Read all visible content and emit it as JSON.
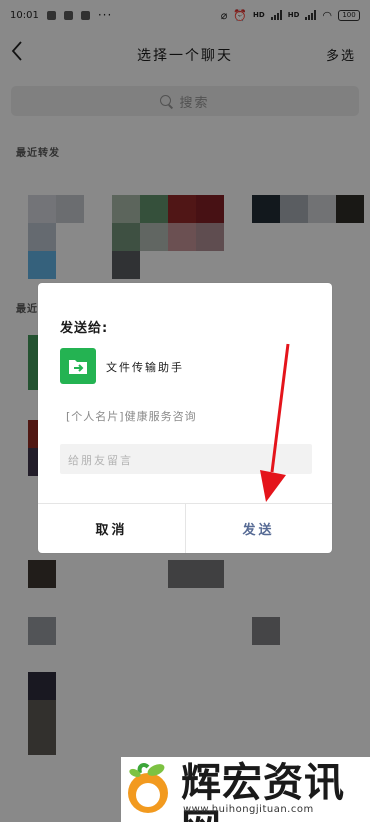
{
  "status_bar": {
    "time": "10:01",
    "dots": "···",
    "hd_label": "HD",
    "battery": "100"
  },
  "nav": {
    "back_icon": "chevron-left",
    "title": "选择一个聊天",
    "multi_select": "多选"
  },
  "search": {
    "placeholder": "搜索",
    "icon": "search-icon"
  },
  "sections": {
    "recent_forward": "最近转发",
    "recent_chats": "最近"
  },
  "dialog": {
    "heading": "发送给:",
    "contact_name": "文件传输助手",
    "contact_icon": "folder-transfer-icon",
    "contact_icon_color": "#24b352",
    "message_preview": "[个人名片]健康服务咨询",
    "note_placeholder": "给朋友留言",
    "cancel_label": "取消",
    "send_label": "发送",
    "send_color": "#576b95"
  },
  "annotation": {
    "arrow_color": "#e4141b"
  },
  "watermark": {
    "brand": "辉宏资讯网",
    "url": "www.huihongjituan.com"
  }
}
